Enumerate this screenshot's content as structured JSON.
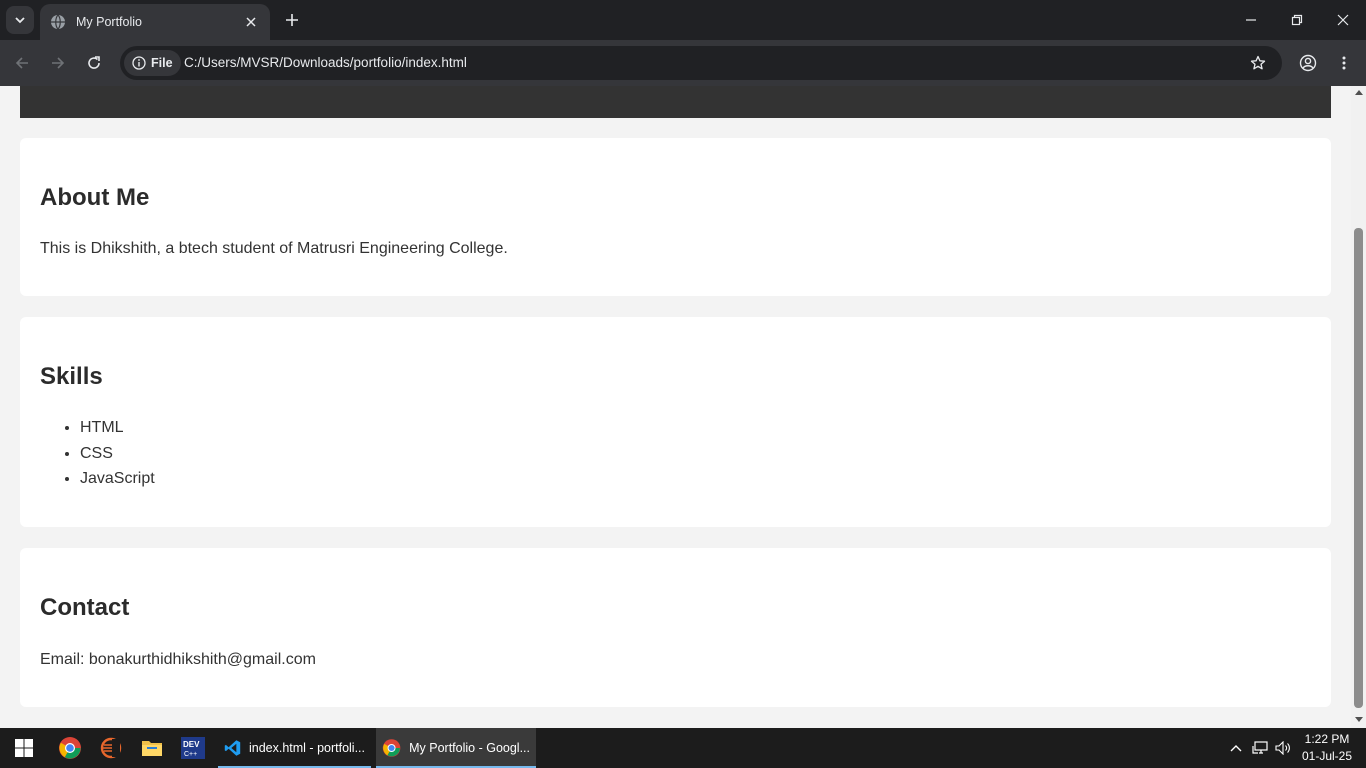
{
  "browser": {
    "tab_title": "My Portfolio",
    "chip_label": "File",
    "url": "C:/Users/MVSR/Downloads/portfolio/index.html"
  },
  "page": {
    "about": {
      "heading": "About Me",
      "text": "This is Dhikshith, a btech student of Matrusri Engineering College."
    },
    "skills": {
      "heading": "Skills",
      "items": [
        "HTML",
        "CSS",
        "JavaScript"
      ]
    },
    "contact": {
      "heading": "Contact",
      "text": "Email: bonakurthidhikshith@gmail.com"
    }
  },
  "taskbar": {
    "apps": [
      {
        "label": "index.html - portfoli..."
      },
      {
        "label": "My Portfolio - Googl..."
      }
    ],
    "time": "1:22 PM",
    "date": "01-Jul-25"
  },
  "colors": {
    "page_bg": "#f3f3f3",
    "header_bar": "#333333",
    "card": "#ffffff",
    "chrome_dark": "#202124",
    "chrome_toolbar": "#35363a",
    "taskbar": "#1c1c1c",
    "active_underline": "#76b9ed"
  }
}
